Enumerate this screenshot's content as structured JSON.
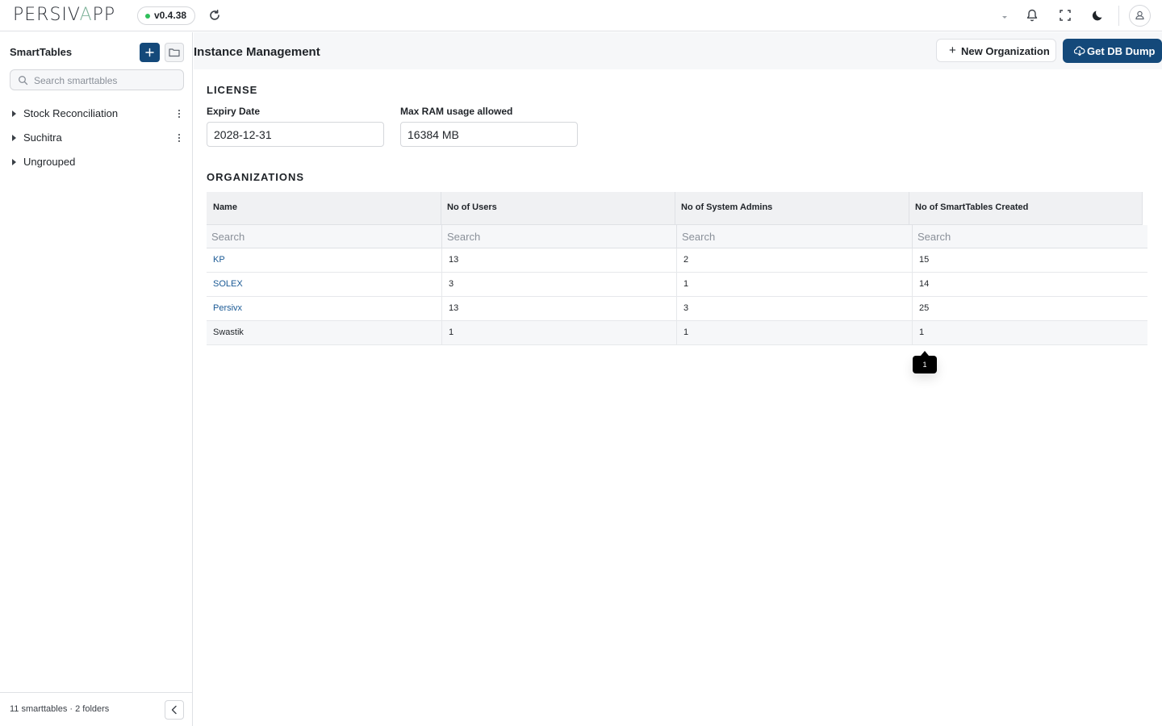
{
  "app": {
    "logo_left": "PERSIV",
    "logo_mid": "A",
    "logo_right": "PP",
    "version": "v0.4.38"
  },
  "sidebar": {
    "title": "SmartTables",
    "search_placeholder": "Search smarttables",
    "items": [
      {
        "label": "Stock Reconciliation",
        "has_menu": true
      },
      {
        "label": "Suchitra",
        "has_menu": true
      },
      {
        "label": "Ungrouped",
        "has_menu": false
      }
    ],
    "footer": "11 smarttables · 2 folders"
  },
  "page": {
    "title": "Instance Management",
    "new_org_label": "New Organization",
    "db_dump_label": "Get DB Dump"
  },
  "license": {
    "section_title": "LICENSE",
    "expiry_label": "Expiry Date",
    "expiry_value": "2028-12-31",
    "ram_label": "Max RAM usage allowed",
    "ram_value": "16384 MB"
  },
  "organizations": {
    "section_title": "ORGANIZATIONS",
    "columns": [
      "Name",
      "No of Users",
      "No of System Admins",
      "No of SmartTables Created"
    ],
    "filter_placeholder": "Search",
    "rows": [
      {
        "name": "KP",
        "users": "13",
        "admins": "2",
        "smarttables": "15"
      },
      {
        "name": "SOLEX",
        "users": "3",
        "admins": "1",
        "smarttables": "14"
      },
      {
        "name": "Persivx",
        "users": "13",
        "admins": "3",
        "smarttables": "25"
      },
      {
        "name": "Swastik",
        "users": "1",
        "admins": "1",
        "smarttables": "1"
      }
    ],
    "tooltip": "1"
  },
  "colors": {
    "primary": "#14497a",
    "link": "#1b5a95",
    "status_online": "#2fbf5a"
  },
  "icons": [
    "refresh-icon",
    "chevron-down-icon",
    "bell-icon",
    "fullscreen-icon",
    "moon-icon",
    "user-icon",
    "plus-icon",
    "folder-icon",
    "search-icon",
    "kebab-icon",
    "collapse-icon",
    "cloud-download-icon"
  ]
}
